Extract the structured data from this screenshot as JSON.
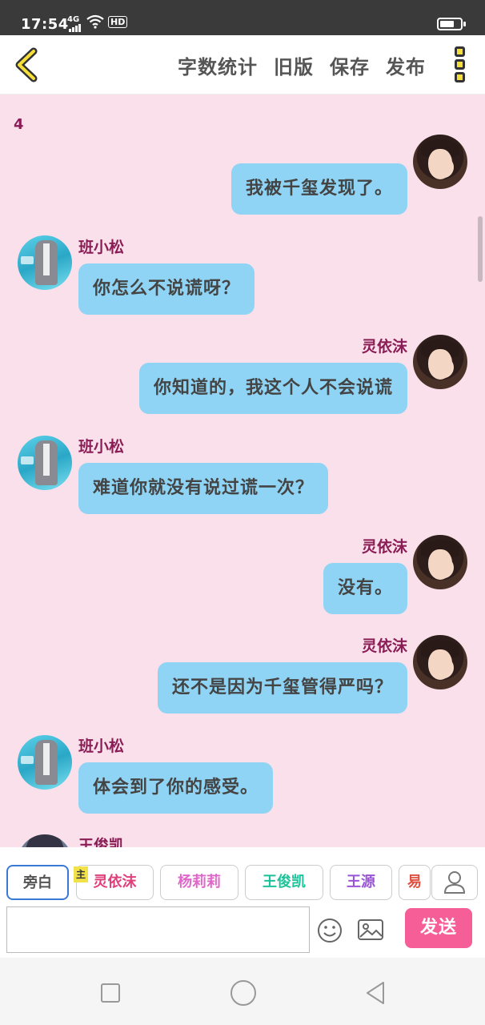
{
  "status_bar": {
    "time": "17:54",
    "network": "4G",
    "hd": "HD",
    "battery_level": 0.7
  },
  "toolbar": {
    "back_icon": "chevron-left-icon",
    "actions": [
      "字数统计",
      "旧版",
      "保存",
      "发布"
    ],
    "more_icon": "more-vertical-icon",
    "accent_color": "#f6df3a"
  },
  "chat": {
    "page_number": "4",
    "messages": [
      {
        "speaker": "",
        "side": "right",
        "text": "我被千玺发现了。",
        "avatar": "girl"
      },
      {
        "speaker": "班小松",
        "side": "left",
        "text": "你怎么不说谎呀？",
        "avatar": "boy"
      },
      {
        "speaker": "灵依沫",
        "side": "right",
        "text": "你知道的，我这个人不会说谎",
        "avatar": "girl"
      },
      {
        "speaker": "班小松",
        "side": "left",
        "text": "难道你就没有说过谎一次？",
        "avatar": "boy"
      },
      {
        "speaker": "灵依沫",
        "side": "right",
        "text": "没有。",
        "avatar": "girl"
      },
      {
        "speaker": "灵依沫",
        "side": "right",
        "text": "还不是因为千玺管得严吗？",
        "avatar": "girl"
      },
      {
        "speaker": "班小松",
        "side": "left",
        "text": "体会到了你的感受。",
        "avatar": "boy"
      },
      {
        "speaker": "王俊凯",
        "side": "left",
        "text": "",
        "avatar": "dark"
      }
    ],
    "bubble_color": "#8fd4f4",
    "name_color": "#8a1d55"
  },
  "input": {
    "main_badge": "主",
    "chips": [
      {
        "label": "旁白",
        "color": "#555555",
        "active": true
      },
      {
        "label": "灵依沫",
        "color": "#e0407a",
        "active": false
      },
      {
        "label": "杨莉莉",
        "color": "#e066c8",
        "active": false
      },
      {
        "label": "王俊凯",
        "color": "#1ec29a",
        "active": false
      },
      {
        "label": "王源",
        "color": "#9a55d6",
        "active": false
      },
      {
        "label": "易",
        "color": "#e05040",
        "active": false
      }
    ],
    "text_value": "",
    "send_label": "发送",
    "send_color": "#f55e96",
    "icons": [
      "user-icon",
      "emoji-icon",
      "image-icon"
    ]
  },
  "navigation": {
    "icons": [
      "recent-apps-icon",
      "home-icon",
      "back-icon"
    ]
  }
}
